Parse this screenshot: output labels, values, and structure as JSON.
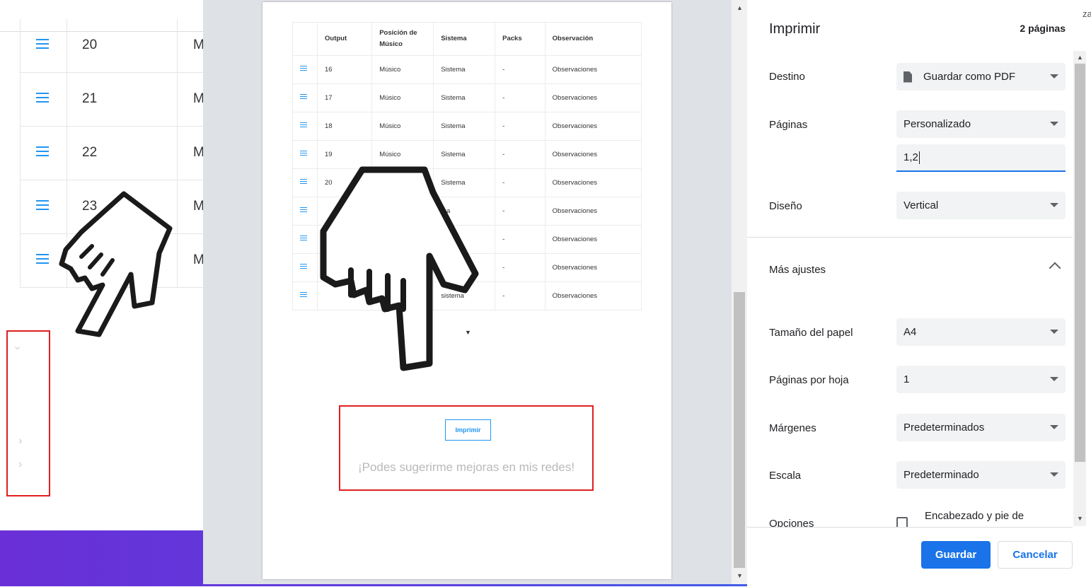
{
  "background_table": {
    "rows": [
      {
        "num": "20",
        "col2": "M"
      },
      {
        "num": "21",
        "col2": "M"
      },
      {
        "num": "22",
        "col2": "M"
      },
      {
        "num": "23",
        "col2": "M"
      },
      {
        "num": "",
        "col2": "M"
      }
    ]
  },
  "preview": {
    "table": {
      "headers": [
        "",
        "Output",
        "Posición de Músico",
        "Sistema",
        "Packs",
        "Observación"
      ],
      "rows": [
        {
          "output": "16",
          "musico": "Músico",
          "sistema": "Sistema",
          "packs": "-",
          "obs": "Observaciones"
        },
        {
          "output": "17",
          "musico": "Músico",
          "sistema": "Sistema",
          "packs": "-",
          "obs": "Observaciones"
        },
        {
          "output": "18",
          "musico": "Músico",
          "sistema": "Sistema",
          "packs": "-",
          "obs": "Observaciones"
        },
        {
          "output": "19",
          "musico": "Músico",
          "sistema": "Sistema",
          "packs": "-",
          "obs": "Observaciones"
        },
        {
          "output": "20",
          "musico": "",
          "sistema": "Sistema",
          "packs": "-",
          "obs": "Observaciones"
        },
        {
          "output": "",
          "musico": "",
          "sistema": "ma",
          "packs": "-",
          "obs": "Observaciones"
        },
        {
          "output": "",
          "musico": "",
          "sistema": "",
          "packs": "-",
          "obs": "Observaciones"
        },
        {
          "output": "",
          "musico": "",
          "sistema": "",
          "packs": "-",
          "obs": "Observaciones"
        },
        {
          "output": "",
          "musico": "",
          "sistema": "sistema",
          "packs": "-",
          "obs": "Observaciones"
        }
      ]
    },
    "print_button": "Imprimir",
    "suggestion": "¡Podes sugerirme mejoras en mis redes!"
  },
  "panel": {
    "title": "Imprimir",
    "page_count": "2 páginas",
    "destino_label": "Destino",
    "destino_value": "Guardar como PDF",
    "paginas_label": "Páginas",
    "paginas_value": "Personalizado",
    "paginas_input": "1,2",
    "diseno_label": "Diseño",
    "diseno_value": "Vertical",
    "mas_ajustes": "Más ajustes",
    "papel_label": "Tamaño del papel",
    "papel_value": "A4",
    "por_hoja_label": "Páginas por hoja",
    "por_hoja_value": "1",
    "margenes_label": "Márgenes",
    "margenes_value": "Predeterminados",
    "escala_label": "Escala",
    "escala_value": "Predeterminado",
    "opciones_label": "Opciones",
    "opcion_encabezado": "Encabezado y pie de",
    "guardar": "Guardar",
    "cancelar": "Cancelar",
    "cut_text": "za"
  },
  "colors": {
    "accent": "#1a73e8",
    "highlight_box": "#e01f1f",
    "table_icon": "#2196f3"
  }
}
